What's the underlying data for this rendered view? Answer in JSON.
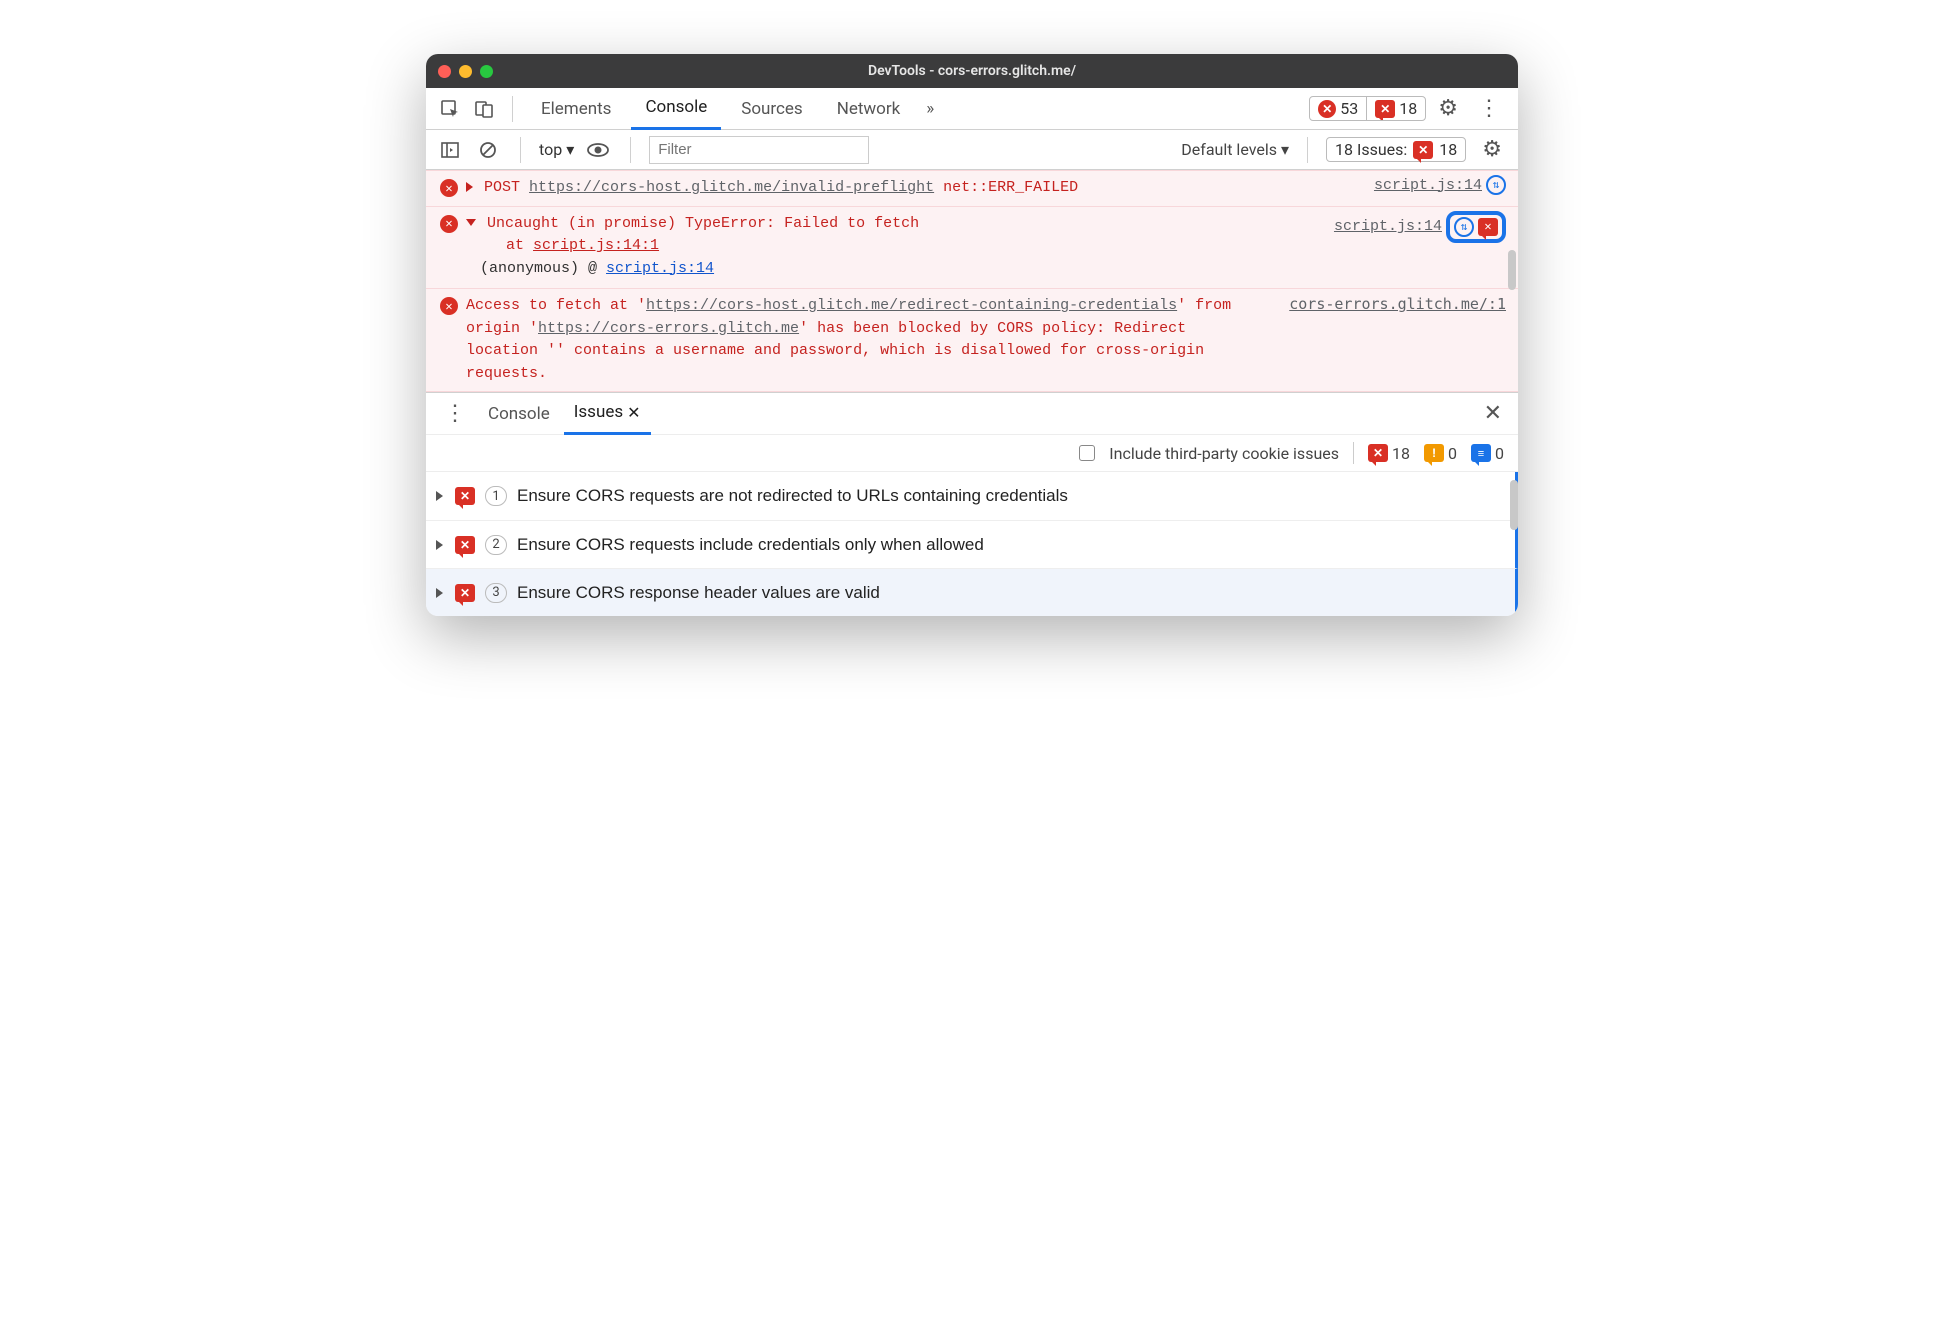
{
  "window": {
    "title": "DevTools - cors-errors.glitch.me/"
  },
  "tabs": {
    "t0": "Elements",
    "t1": "Console",
    "t2": "Sources",
    "t3": "Network",
    "more": "»"
  },
  "topBadges": {
    "errors": "53",
    "issues": "18"
  },
  "console_toolbar": {
    "context": "top",
    "filter_placeholder": "Filter",
    "levels": "Default levels",
    "issues_label": "18 Issues:",
    "issues_count": "18"
  },
  "msgs": {
    "m1": {
      "method": "POST",
      "url": "https://cors-host.glitch.me/invalid-preflight",
      "err": "net::ERR_FAILED",
      "src": "script.js:14"
    },
    "m2": {
      "head": "Uncaught (in promise) TypeError: Failed to fetch",
      "at": "at ",
      "loc": "script.js:14:1",
      "anon": "(anonymous) @ ",
      "anon_loc": "script.js:14",
      "src": "script.js:14"
    },
    "m3": {
      "p1": "Access to fetch at '",
      "url1a": "https://cors-host.glitch.me/redi",
      "url1b": "rect-containing-credentials",
      "p2": "' from origin '",
      "url2": "https://cors-errors.glitch.me",
      "p3": "' has been blocked by CORS policy: Redirect location '' contains a username and password, which is disallowed for cross-origin requests.",
      "src": "cors-errors.glitch.me/:1"
    }
  },
  "drawer": {
    "tabs": {
      "console": "Console",
      "issues": "Issues"
    },
    "include_label": "Include third-party cookie issues",
    "counts": {
      "err": "18",
      "warn": "0",
      "info": "0"
    },
    "items": {
      "i1": {
        "count": "1",
        "text": "Ensure CORS requests are not redirected to URLs containing credentials"
      },
      "i2": {
        "count": "2",
        "text": "Ensure CORS requests include credentials only when allowed"
      },
      "i3": {
        "count": "3",
        "text": "Ensure CORS response header values are valid"
      }
    }
  }
}
